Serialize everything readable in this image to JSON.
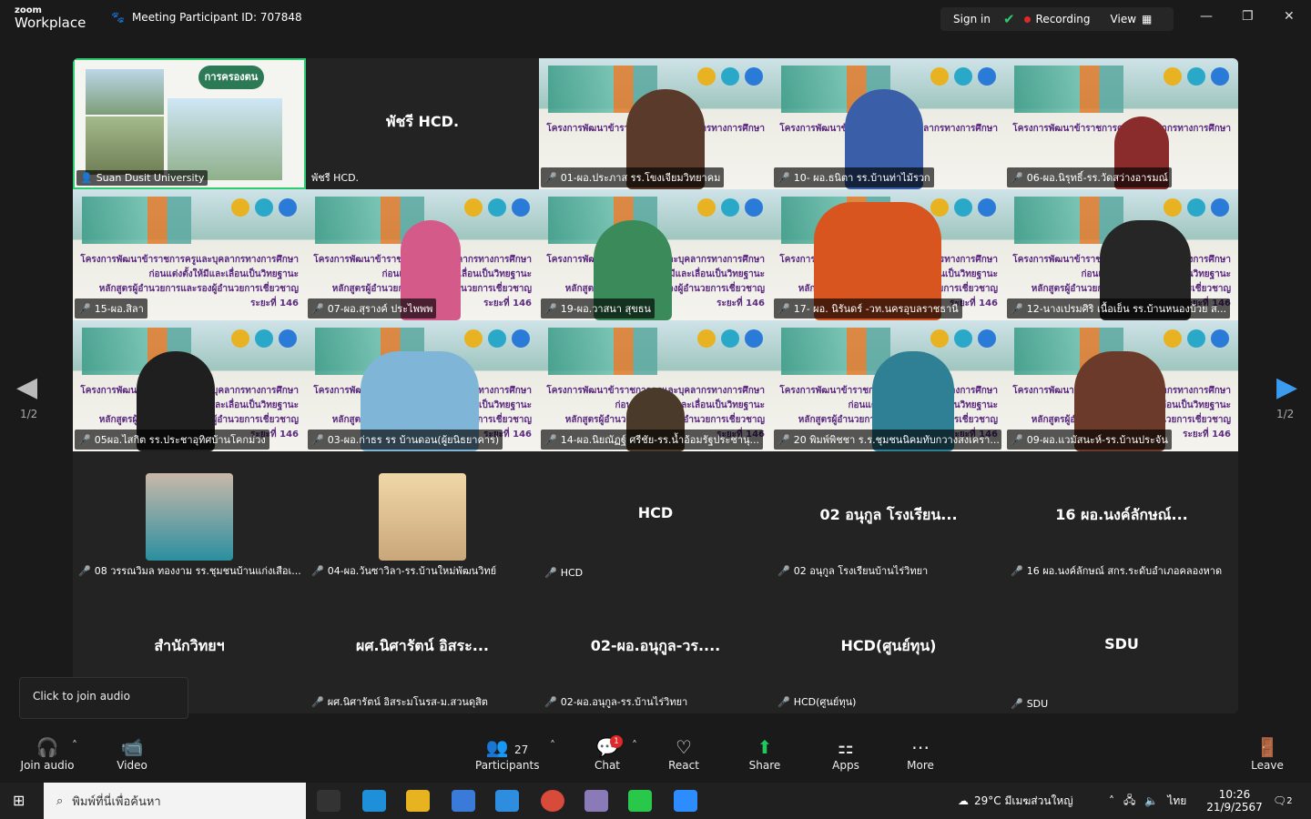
{
  "app": {
    "logo_small": "zoom",
    "logo_big": "Workplace",
    "meeting_id": "Meeting Participant ID: 707848"
  },
  "topbar": {
    "sign_in": "Sign in",
    "recording": "Recording",
    "view": "View"
  },
  "tiles": [
    {
      "label": "Suan Dusit University",
      "slide_title": "การครองตน"
    },
    {
      "label": "พัชรี HCD.",
      "big": "พัชรี HCD."
    },
    {
      "label": "01-ผอ.ประภาส รร.โขงเจียมวิทยาคม"
    },
    {
      "label": "10- ผอ.ธนิตา รร.บ้านท่าไม้รวก"
    },
    {
      "label": "06-ผอ.นิรุทธิ์-รร.วัดสว่างอารมณ์"
    },
    {
      "label": "15-ผอ.สิลา"
    },
    {
      "label": "07-ผอ.สุรางค์ ประไพพพ"
    },
    {
      "label": "19-ผอ.วาสนา สุขธน"
    },
    {
      "label": "17- ผอ. นิรันดร์ -วท.นครอุบลราชธานี"
    },
    {
      "label": "12-นางเปรมศิริ เนื้อเย็น รร.บ้านหนองบ้วย ส..."
    },
    {
      "label": "05ผอ.ไสกิต   รร.ประชาอุทิศบ้านโคกม่วง"
    },
    {
      "label": "03-ผอ.ก่าธร รร บ้านดอน(ผู้ยนิธยาคาร)"
    },
    {
      "label": "14-ผอ.นิยณัฏฐ์ ศรีชัย-รร.น้ำอ้อมรัฐประชานุ..."
    },
    {
      "label": "20 พิมพ์พิชชา ร.ร.ชุมชนนิคมทับกวางสงเครา..."
    },
    {
      "label": "09-ผอ.แวมัสนะห์-รร.บ้านประจัน"
    },
    {
      "label": "08 วรรณวิมล ทองงาม รร.ชุมชนบ้านแก่งเสือเ..."
    },
    {
      "label": "04-ผอ.วันซาวิลา-รร.บ้านใหม่พัฒนวิทย์"
    },
    {
      "label": "HCD",
      "big": "HCD"
    },
    {
      "label": "02 อนุกูล โรงเรียนบ้านไร่วิทยา",
      "big": "02 อนุกูล โรงเรียน..."
    },
    {
      "label": "16 ผอ.นงค์ลักษณ์ สกร.ระดับอำเภอคลองหาด",
      "big": "16 ผอ.นงค์ลักษณ์..."
    },
    {
      "label": "",
      "big": "สำนักวิทยฯ"
    },
    {
      "label": "ผศ.นิศารัตน์ อิสระมโนรส-ม.สวนดุสิต",
      "big": "ผศ.นิศารัตน์ อิสระ..."
    },
    {
      "label": "02-ผอ.อนุกูล-รร.บ้านไร่วิทยา",
      "big": "02-ผอ.อนุกูล-วร...."
    },
    {
      "label": "HCD(ศูนย์ทุน)",
      "big": "HCD(ศูนย์ทุน)"
    },
    {
      "label": "SDU",
      "big": "SDU"
    }
  ],
  "banner_lines": [
    "โครงการพัฒนาข้าราชการครูและบุคลากรทางการศึกษา",
    "ก่อนแต่งตั้งให้มีและเลื่อนเป็นวิทยฐานะ",
    "หลักสูตรผู้อำนวยการและรองผู้อำนวยการเชี่ยวชาญ ระยะที่ 146"
  ],
  "pager": {
    "page": "1/2"
  },
  "tooltip": "Click to join audio",
  "toolbar": {
    "join_audio": "Join audio",
    "video": "Video",
    "participants": "Participants",
    "participants_count": "27",
    "chat": "Chat",
    "chat_badge": "1",
    "react": "React",
    "share": "Share",
    "apps": "Apps",
    "more": "More",
    "leave": "Leave"
  },
  "taskbar": {
    "search_placeholder": "พิมพ์ที่นี่เพื่อค้นหา",
    "weather": "29°C  มีเมฆส่วนใหญ่",
    "lang": "ไทย",
    "time": "10:26",
    "date": "21/9/2567",
    "notif": "2"
  },
  "colors": {
    "active_border": "#2ecc71",
    "mic_muted": "#e0354a",
    "recording": "#e02828",
    "share": "#22c55e",
    "nav_arrow": "#3a9bf0"
  }
}
